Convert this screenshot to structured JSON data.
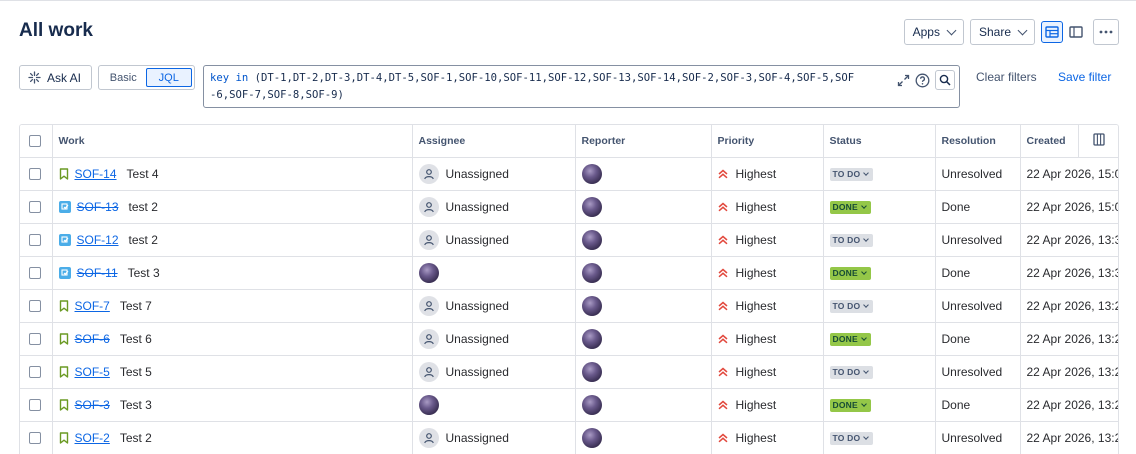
{
  "header": {
    "title": "All work",
    "apps_label": "Apps",
    "share_label": "Share"
  },
  "toolbar": {
    "ask_ai_label": "Ask AI",
    "mode_basic": "Basic",
    "mode_jql": "JQL",
    "jql_keyword": "key in",
    "jql_rest": " (DT-1,DT-2,DT-3,DT-4,DT-5,SOF-1,SOF-10,SOF-11,SOF-12,SOF-13,SOF-14,SOF-2,SOF-3,SOF-4,SOF-5,SOF-6,SOF-7,SOF-8,SOF-9)",
    "clear_filters": "Clear filters",
    "save_filter": "Save filter"
  },
  "table": {
    "columns": [
      "Work",
      "Assignee",
      "Reporter",
      "Priority",
      "Status",
      "Resolution",
      "Created"
    ],
    "rows": [
      {
        "type": "story",
        "key": "SOF-14",
        "resolved": false,
        "summary": "Test 4",
        "assignee": "Unassigned",
        "priority": "Highest",
        "status": "TO DO",
        "resolution": "Unresolved",
        "created": "22 Apr 2026, 15:0"
      },
      {
        "type": "task",
        "key": "SOF-13",
        "resolved": true,
        "summary": "test 2",
        "assignee": "Unassigned",
        "priority": "Highest",
        "status": "DONE",
        "resolution": "Done",
        "created": "22 Apr 2026, 15:0"
      },
      {
        "type": "task",
        "key": "SOF-12",
        "resolved": false,
        "summary": "test 2",
        "assignee": "Unassigned",
        "priority": "Highest",
        "status": "TO DO",
        "resolution": "Unresolved",
        "created": "22 Apr 2026, 13:3"
      },
      {
        "type": "task",
        "key": "SOF-11",
        "resolved": true,
        "summary": "Test 3",
        "assignee": "",
        "priority": "Highest",
        "status": "DONE",
        "resolution": "Done",
        "created": "22 Apr 2026, 13:3"
      },
      {
        "type": "story",
        "key": "SOF-7",
        "resolved": false,
        "summary": "Test 7",
        "assignee": "Unassigned",
        "priority": "Highest",
        "status": "TO DO",
        "resolution": "Unresolved",
        "created": "22 Apr 2026, 13:2"
      },
      {
        "type": "story",
        "key": "SOF-6",
        "resolved": true,
        "summary": "Test 6",
        "assignee": "Unassigned",
        "priority": "Highest",
        "status": "DONE",
        "resolution": "Done",
        "created": "22 Apr 2026, 13:2"
      },
      {
        "type": "story",
        "key": "SOF-5",
        "resolved": false,
        "summary": "Test 5",
        "assignee": "Unassigned",
        "priority": "Highest",
        "status": "TO DO",
        "resolution": "Unresolved",
        "created": "22 Apr 2026, 13:2"
      },
      {
        "type": "story",
        "key": "SOF-3",
        "resolved": true,
        "summary": "Test 3",
        "assignee": "",
        "priority": "Highest",
        "status": "DONE",
        "resolution": "Done",
        "created": "22 Apr 2026, 13:2"
      },
      {
        "type": "story",
        "key": "SOF-2",
        "resolved": false,
        "summary": "Test 2",
        "assignee": "Unassigned",
        "priority": "Highest",
        "status": "TO DO",
        "resolution": "Unresolved",
        "created": "22 Apr 2026, 13:2"
      }
    ]
  },
  "colors": {
    "accent": "#0c66e4",
    "priority_highest": "#e2483d",
    "story_icon": "#6a9a23",
    "task_icon": "#4bade8",
    "done_lozenge": "#94c748",
    "todo_lozenge": "#dcdfe4"
  }
}
